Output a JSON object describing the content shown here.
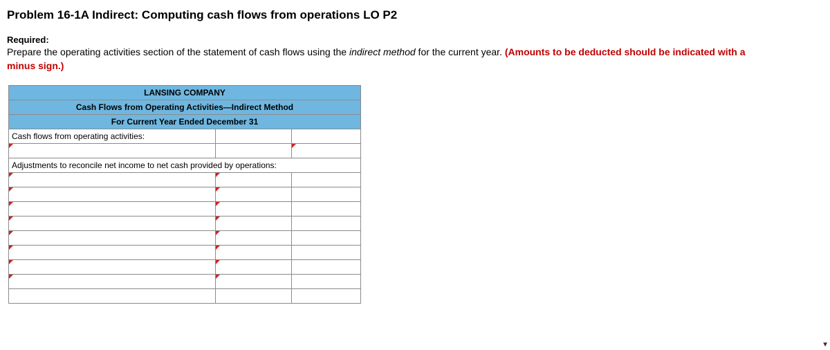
{
  "title": "Problem 16-1A Indirect: Computing cash flows from operations LO P2",
  "required_label": "Required:",
  "instructions": {
    "part1": "Prepare the operating activities section of the statement of cash flows using the ",
    "italic": "indirect method",
    "part2": " for the current year. ",
    "red": "(Amounts to be deducted should be indicated with a minus sign.)"
  },
  "table": {
    "company": "LANSING COMPANY",
    "subtitle": "Cash Flows from Operating Activities—Indirect Method",
    "period": "For Current Year Ended December 31",
    "section1": "Cash flows from operating activities:",
    "section2": "Adjustments to reconcile net income to net cash provided by operations:"
  }
}
